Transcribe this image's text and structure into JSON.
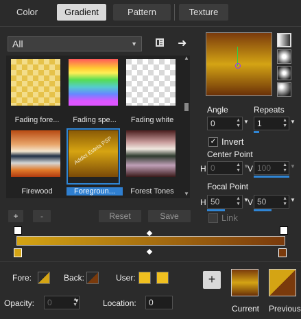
{
  "tabs": [
    {
      "label": "Color",
      "active": false
    },
    {
      "label": "Gradient",
      "active": true
    },
    {
      "label": "Pattern",
      "active": false
    },
    {
      "label": "Texture",
      "active": false
    }
  ],
  "library": {
    "category": "All",
    "thumbnails": [
      {
        "label": "Fading fore..."
      },
      {
        "label": "Fading spe..."
      },
      {
        "label": "Fading white"
      },
      {
        "label": "Firewood"
      },
      {
        "label": "Foregroun...",
        "selected": true
      },
      {
        "label": "Forest Tones"
      }
    ],
    "watermark": "Addict Estela Tutoriels PSP"
  },
  "editor_buttons": {
    "add": "+",
    "remove": "-",
    "reset": "Reset",
    "save": "Save"
  },
  "angle": {
    "label": "Angle",
    "value": "0"
  },
  "repeats": {
    "label": "Repeats",
    "value": "1"
  },
  "invert": {
    "label": "Invert",
    "checked": true
  },
  "center_point": {
    "label": "Center Point",
    "h_label": "H",
    "h_value": "0",
    "v_label": "V",
    "v_value": "100"
  },
  "focal_point": {
    "label": "Focal Point",
    "h_label": "H",
    "h_value": "50",
    "v_label": "V",
    "v_value": "50"
  },
  "link": {
    "label": "Link"
  },
  "bottom": {
    "fore_label": "Fore:",
    "back_label": "Back:",
    "user_label": "User:",
    "opacity_label": "Opacity:",
    "opacity_value": "0",
    "location_label": "Location:",
    "location_value": "0",
    "add_button": "+",
    "current_label": "Current",
    "previous_label": "Previous"
  },
  "colors": {
    "gold": "#d4a414",
    "brown": "#7a3a0c",
    "accent": "#2f86d6"
  }
}
